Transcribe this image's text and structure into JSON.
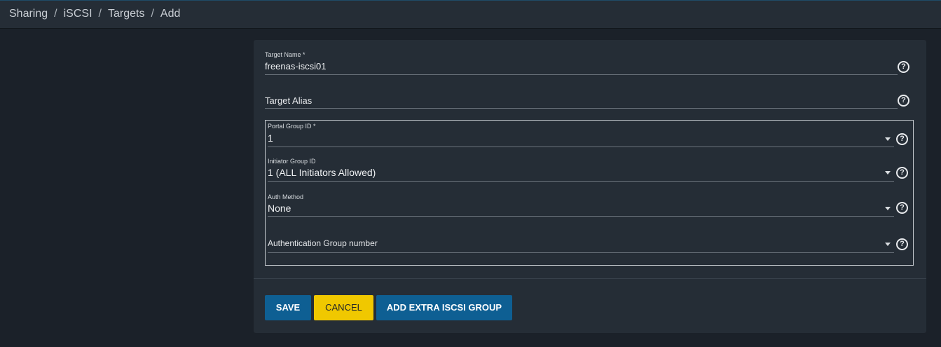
{
  "breadcrumb": [
    "Sharing",
    "iSCSI",
    "Targets",
    "Add"
  ],
  "form": {
    "target_name": {
      "label": "Target Name *",
      "value": "freenas-iscsi01"
    },
    "target_alias": {
      "placeholder": "Target Alias"
    },
    "group": {
      "portal_group": {
        "label": "Portal Group ID *",
        "value": "1"
      },
      "initiator_group": {
        "label": "Initiator Group ID",
        "value": "1 (ALL Initiators Allowed)"
      },
      "auth_method": {
        "label": "Auth Method",
        "value": "None"
      },
      "auth_group": {
        "placeholder": "Authentication Group number"
      }
    }
  },
  "buttons": {
    "save": "SAVE",
    "cancel": "CANCEL",
    "add_group": "ADD EXTRA ISCSI GROUP"
  },
  "icons": {
    "help": "help-circle-icon",
    "dropdown": "caret-down-icon"
  },
  "colors": {
    "background": "#1b2129",
    "panel": "#252d36",
    "primary": "#0e5f93",
    "warning": "#f0c800"
  }
}
